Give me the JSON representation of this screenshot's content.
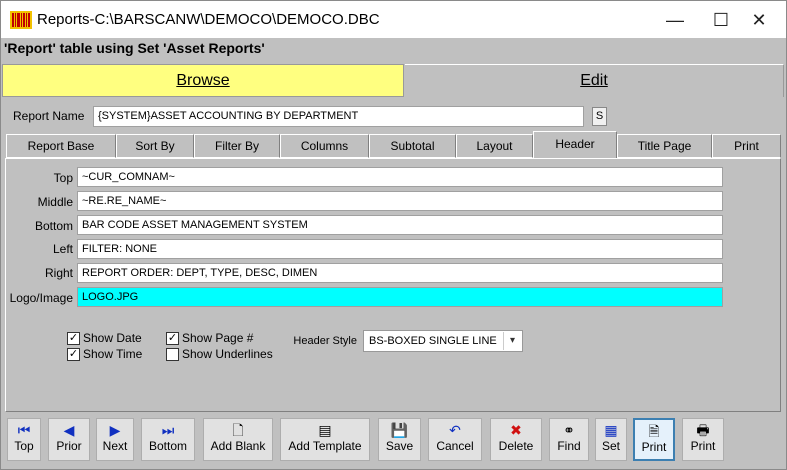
{
  "window": {
    "title": "Reports-C:\\BARSCANW\\DEMOCO\\DEMOCO.DBC",
    "minimize": "—",
    "maximize": "☐",
    "close": "✕"
  },
  "subtitle": "'Report' table using Set 'Asset Reports'",
  "mode_tabs": {
    "browse": "Browse",
    "edit": "Edit"
  },
  "report_name": {
    "label": "Report Name",
    "value": "{SYSTEM}ASSET ACCOUNTING BY DEPARTMENT",
    "s_button": "S"
  },
  "tabs": [
    "Report Base",
    "Sort By",
    "Filter By",
    "Columns",
    "Subtotal",
    "Layout",
    "Header",
    "Title Page",
    "Print"
  ],
  "active_tab": "Header",
  "header_fields": {
    "top": {
      "label": "Top",
      "value": "~CUR_COMNAM~"
    },
    "middle": {
      "label": "Middle",
      "value": "~RE.RE_NAME~"
    },
    "bottom": {
      "label": "Bottom",
      "value": "BAR CODE ASSET MANAGEMENT SYSTEM"
    },
    "left": {
      "label": "Left",
      "value": "FILTER: NONE"
    },
    "right": {
      "label": "Right",
      "value": "REPORT ORDER: DEPT, TYPE, DESC, DIMEN"
    },
    "logo": {
      "label": "Logo/Image",
      "value": "LOGO.JPG"
    }
  },
  "checkboxes": {
    "show_date": {
      "label": "Show Date",
      "checked": true,
      "mark": "✓"
    },
    "show_time": {
      "label": "Show Time",
      "checked": true,
      "mark": "✓"
    },
    "show_page": {
      "label": "Show Page #",
      "checked": true,
      "mark": "✓"
    },
    "show_underlines": {
      "label": "Show Underlines",
      "checked": false,
      "mark": ""
    }
  },
  "header_style": {
    "label": "Header Style",
    "value": "BS-BOXED SINGLE LINE"
  },
  "toolbar": {
    "top": {
      "label": "Top",
      "icon": "first-record-icon"
    },
    "prior": {
      "label": "Prior",
      "icon": "previous-icon"
    },
    "next": {
      "label": "Next",
      "icon": "next-icon"
    },
    "bottom": {
      "label": "Bottom",
      "icon": "last-record-icon"
    },
    "add_blank": {
      "label": "Add Blank",
      "icon": "new-document-icon"
    },
    "add_template": {
      "label": "Add Template",
      "icon": "template-icon"
    },
    "save": {
      "label": "Save",
      "icon": "floppy-disk-icon"
    },
    "cancel": {
      "label": "Cancel",
      "icon": "undo-icon"
    },
    "delete": {
      "label": "Delete",
      "icon": "red-x-icon"
    },
    "find": {
      "label": "Find",
      "icon": "binoculars-icon"
    },
    "set": {
      "label": "Set",
      "icon": "set-icon"
    },
    "print_preview": {
      "label": "Print",
      "icon": "print-preview-icon"
    },
    "print": {
      "label": "Print",
      "icon": "printer-icon"
    }
  },
  "colors": {
    "browse_tab": "#ffff80",
    "logo_field": "#00ffff",
    "background": "#c0c0c0"
  }
}
